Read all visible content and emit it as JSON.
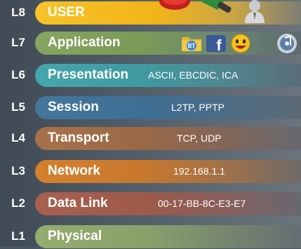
{
  "layers": [
    {
      "tag": "L8",
      "name": "USER",
      "example": "",
      "color": "#f2b419"
    },
    {
      "tag": "L7",
      "name": "Application",
      "example": "",
      "color": "#7a9a57"
    },
    {
      "tag": "L6",
      "name": "Presentation",
      "example": "ASCII, EBCDIC, ICA",
      "color": "#3f9aa0"
    },
    {
      "tag": "L5",
      "name": "Session",
      "example": "L2TP, PPTP",
      "color": "#3d6e94"
    },
    {
      "tag": "L4",
      "name": "Transport",
      "example": "TCP, UDP",
      "color": "#9a6846"
    },
    {
      "tag": "L3",
      "name": "Network",
      "example": "192.168.1.1",
      "color": "#c8782c"
    },
    {
      "tag": "L2",
      "name": "Data Link",
      "example": "00-17-BB-8C-E3-E7",
      "color": "#9e5a4a"
    },
    {
      "tag": "L1",
      "name": "Physical",
      "example": "",
      "color": "#8aa26a"
    }
  ],
  "icons": {
    "bt_text": "BT",
    "fb_text": "f",
    "user_icons": [
      "red-cone-icon",
      "green-cone-icon",
      "person-icon"
    ],
    "app_icons": [
      "bittorrent-folder-icon",
      "facebook-icon",
      "smiley-messenger-icon",
      "itunes-music-icon"
    ]
  }
}
